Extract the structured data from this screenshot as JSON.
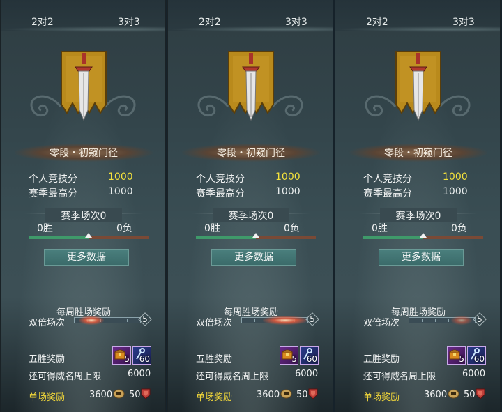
{
  "colors": {
    "accent_yellow": "#f4e23c",
    "win_green": "#3f9a6a",
    "loss_red": "#7a4a36",
    "button_teal": "#3b6b6a"
  },
  "panels": [
    {
      "tabs": [
        "2对2",
        "3对3"
      ],
      "emblem": "sword-banner-icon",
      "rank": "零段・初窥门径",
      "personal_score_label": "个人竞技分",
      "personal_score": "1000",
      "season_high_label": "赛季最高分",
      "season_high": "1000",
      "season_matches": "赛季场次0",
      "wins": "0胜",
      "losses": "0负",
      "win_ratio": 0.5,
      "more_button": "更多数据",
      "weekly_title": "每周胜场奖励",
      "double_label": "双倍场次",
      "weekly_count": "5",
      "five_win_label": "五胜奖励",
      "item1_count": "5",
      "item2_count": "60",
      "prestige_label": "还可得威名周上限",
      "prestige_value": "6000",
      "single_label": "单场奖励",
      "single_value1": "3600",
      "single_value2": "50"
    },
    {
      "tabs": [
        "2对2",
        "3对3"
      ],
      "emblem": "sword-banner-icon",
      "rank": "零段・初窥门径",
      "personal_score_label": "个人竞技分",
      "personal_score": "1000",
      "season_high_label": "赛季最高分",
      "season_high": "1000",
      "season_matches": "赛季场次0",
      "wins": "0胜",
      "losses": "0负",
      "win_ratio": 0.5,
      "more_button": "更多数据",
      "weekly_title": "每周胜场奖励",
      "double_label": "双倍场次",
      "weekly_count": "5",
      "five_win_label": "五胜奖励",
      "item1_count": "5",
      "item2_count": "60",
      "prestige_label": "还可得威名周上限",
      "prestige_value": "6000",
      "single_label": "单场奖励",
      "single_value1": "3600",
      "single_value2": "50"
    },
    {
      "tabs": [
        "2对2",
        "3对3"
      ],
      "emblem": "sword-banner-icon",
      "rank": "零段・初窥门径",
      "personal_score_label": "个人竞技分",
      "personal_score": "1000",
      "season_high_label": "赛季最高分",
      "season_high": "1000",
      "season_matches": "赛季场次0",
      "wins": "0胜",
      "losses": "0负",
      "win_ratio": 0.5,
      "more_button": "更多数据",
      "weekly_title": "每周胜场奖励",
      "double_label": "双倍场次",
      "weekly_count": "5",
      "five_win_label": "五胜奖励",
      "item1_count": "5",
      "item2_count": "60",
      "prestige_label": "还可得威名周上限",
      "prestige_value": "6000",
      "single_label": "单场奖励",
      "single_value1": "3600",
      "single_value2": "50"
    }
  ]
}
